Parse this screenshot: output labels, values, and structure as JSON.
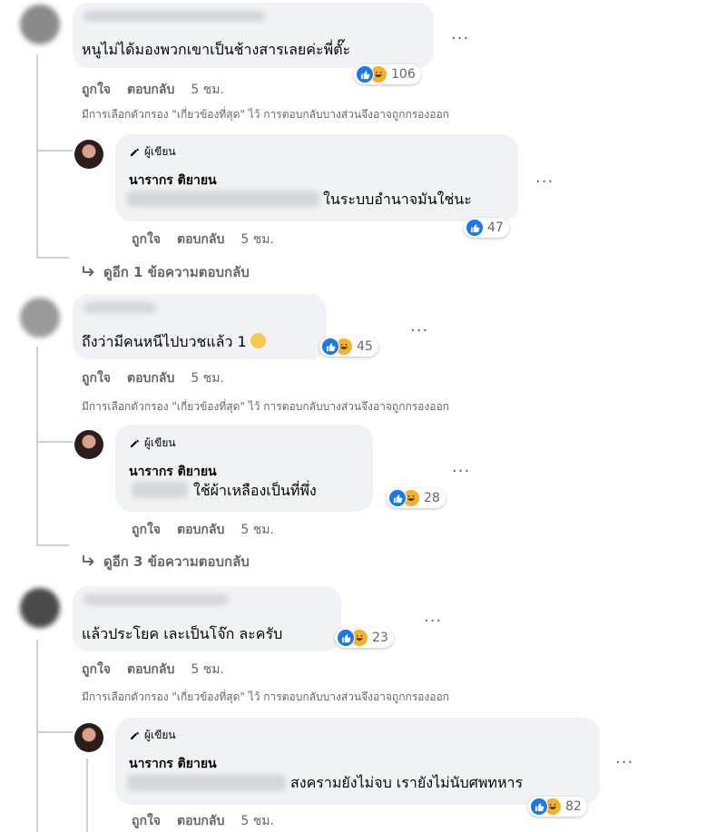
{
  "comments": [
    {
      "text": "หนูไม่ได้มองพวกเขาเป็นช้างสารเลยค่ะพี่ตั๊ะ",
      "reaction_count": "106",
      "actions": {
        "like": "ถูกใจ",
        "reply": "ตอบกลับ",
        "time": "5 ชม."
      },
      "filter_note": "มีการเลือกตัวกรอง \"เกี่ยวข้องที่สุด\" ไว้ การตอบกลับบางส่วนจึงอาจถูกกรองออก",
      "reply": {
        "badge": "ผู้เขียน",
        "author": "นารากร ติยายน",
        "text": "ในระบบอำนาจมันใช่นะ",
        "reaction_count": "47",
        "actions": {
          "like": "ถูกใจ",
          "reply": "ตอบกลับ",
          "time": "5 ชม."
        }
      },
      "view_more": "ดูอีก 1 ข้อความตอบกลับ"
    },
    {
      "text": "ถึงว่ามีคนหนีไปบวชแล้ว 1",
      "reaction_count": "45",
      "actions": {
        "like": "ถูกใจ",
        "reply": "ตอบกลับ",
        "time": "5 ชม."
      },
      "filter_note": "มีการเลือกตัวกรอง \"เกี่ยวข้องที่สุด\" ไว้ การตอบกลับบางส่วนจึงอาจถูกกรองออก",
      "reply": {
        "badge": "ผู้เขียน",
        "author": "นารากร ติยายน",
        "text": "ใช้ผ้าเหลืองเป็นที่พึ่ง",
        "reaction_count": "28",
        "actions": {
          "like": "ถูกใจ",
          "reply": "ตอบกลับ",
          "time": "5 ชม."
        }
      },
      "view_more": "ดูอีก 3 ข้อความตอบกลับ"
    },
    {
      "text": "แล้วประโยค เละเป็นโจ๊ก ละครับ",
      "reaction_count": "23",
      "actions": {
        "like": "ถูกใจ",
        "reply": "ตอบกลับ",
        "time": "5 ชม."
      },
      "filter_note": "มีการเลือกตัวกรอง \"เกี่ยวข้องที่สุด\" ไว้ การตอบกลับบางส่วนจึงอาจถูกกรองออก",
      "reply": {
        "badge": "ผู้เขียน",
        "author": "นารากร ติยายน",
        "text": "สงครามยังไม่จบ เรายังไม่นับศพทหาร",
        "reaction_count": "82",
        "actions": {
          "like": "ถูกใจ",
          "reply": "ตอบกลับ",
          "time": "5 ชม."
        }
      }
    }
  ],
  "icons": {
    "like": "thumbs-up-icon",
    "haha": "haha-emoji-icon",
    "more": "more-dots-icon",
    "reply_arrow": "reply-arrow-icon",
    "pencil": "pencil-icon",
    "smile": "grinning-emoji"
  },
  "colors": {
    "like": "#1877f2",
    "haha": "#f7b125",
    "bubble": "#f0f2f5",
    "meta": "#65676b"
  }
}
